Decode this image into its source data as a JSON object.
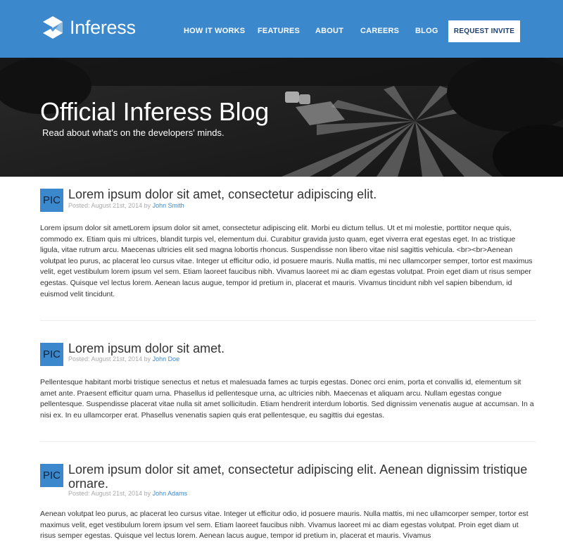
{
  "nav": {
    "brand": "Inferess",
    "links": [
      {
        "label": "HOW IT WORKS"
      },
      {
        "label": "FEATURES"
      },
      {
        "label": "ABOUT"
      },
      {
        "label": "CAREERS"
      },
      {
        "label": "BLOG"
      }
    ],
    "cta": "REQUEST INVITE"
  },
  "hero": {
    "title": "Official Inferess Blog",
    "subtitle": "Read about what's on the developers' minds."
  },
  "posts": [
    {
      "pic": "PIC",
      "title": "Lorem ipsum dolor sit amet, consectetur adipiscing elit.",
      "posted_prefix": "Posted: August 21st, 2014 by ",
      "author": "John Smith",
      "body": "Lorem ipsum dolor sit ametLorem ipsum dolor sit amet, consectetur adipiscing elit. Morbi eu dictum tellus. Ut et mi molestie, porttitor neque quis, commodo ex. Etiam quis mi ultrices, blandit turpis vel, elementum dui. Curabitur gravida justo quam, eget viverra erat egestas eget. In ac tristique ligula, vitae rutrum arcu. Maecenas ultricies elit sed magna lobortis rhoncus. Suspendisse non libero vitae nisl sagittis vehicula. <br><br>Aenean volutpat leo purus, ac placerat leo cursus vitae. Integer ut efficitur odio, id posuere mauris. Nulla mattis, mi nec ullamcorper semper, tortor est maximus velit, eget vestibulum lorem ipsum vel sem. Etiam laoreet faucibus nibh. Vivamus laoreet mi ac diam egestas volutpat. Proin eget diam ut risus semper egestas. Quisque vel lectus lorem. Aenean lacus augue, tempor id pretium in, placerat et mauris. Vivamus tincidunt nibh vel sapien bibendum, id euismod velit tincidunt."
    },
    {
      "pic": "PIC",
      "title": "Lorem ipsum dolor sit amet.",
      "posted_prefix": "Posted: August 21st, 2014 by ",
      "author": "John Doe",
      "body": "Pellentesque habitant morbi tristique senectus et netus et malesuada fames ac turpis egestas. Donec orci enim, porta et convallis id, elementum sit amet ante. Praesent efficitur quam urna. Phasellus id pellentesque urna, ac ultricies nibh. Maecenas et aliquam arcu. Nullam egestas congue pellentesque. Suspendisse placerat vitae nulla sit amet sollicitudin. Etiam hendrerit interdum lobortis. Sed dignissim venenatis augue at accumsan. In a nisi ex. In eu ullamcorper erat. Phasellus venenatis sapien quis erat pellentesque, eu sagittis dui egestas."
    },
    {
      "pic": "PIC",
      "title": "Lorem ipsum dolor sit amet, consectetur adipiscing elit. Aenean dignissim tristique ornare.",
      "posted_prefix": "Posted: August 21st, 2014 by ",
      "author": "John Adams",
      "body": "Aenean volutpat leo purus, ac placerat leo cursus vitae. Integer ut efficitur odio, id posuere mauris. Nulla mattis, mi nec ullamcorper semper, tortor est maximus velit, eget vestibulum lorem ipsum vel sem. Etiam laoreet faucibus nibh. Vivamus laoreet mi ac diam egestas volutpat. Proin eget diam ut risus semper egestas. Quisque vel lectus lorem. Aenean lacus augue, tempor id pretium in, placerat et mauris. Vivamus"
    }
  ]
}
